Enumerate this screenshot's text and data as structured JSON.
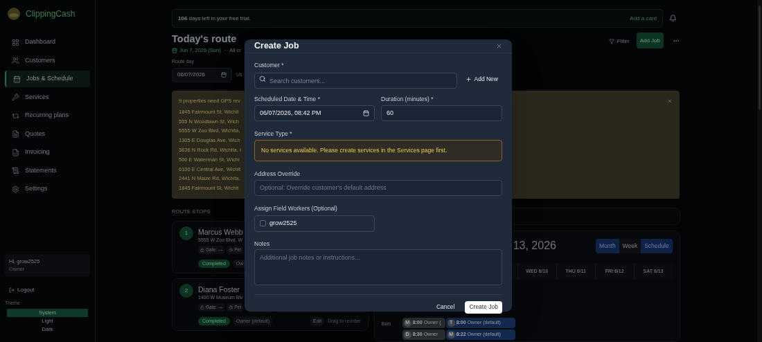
{
  "sidebar": {
    "brand": "ClippingCash",
    "items": [
      {
        "label": "Dashboard",
        "selected": false
      },
      {
        "label": "Customers",
        "selected": false
      },
      {
        "label": "Jobs & Schedule",
        "selected": true
      },
      {
        "label": "Services",
        "selected": false
      },
      {
        "label": "Recurring plans",
        "selected": false
      },
      {
        "label": "Quotes",
        "selected": false
      },
      {
        "label": "Invoicing",
        "selected": false
      },
      {
        "label": "Statements",
        "selected": false
      },
      {
        "label": "Settings",
        "selected": false
      }
    ],
    "user": {
      "greeting": "Hi, grow2525",
      "role": "Owner"
    },
    "logout": "Logout",
    "theme": {
      "label": "Theme",
      "options": [
        {
          "label": "System",
          "selected": true
        },
        {
          "label": "Light",
          "selected": false
        },
        {
          "label": "Dark",
          "selected": false
        }
      ]
    }
  },
  "trial": {
    "text": "**106** days left in your free trial.",
    "action": "Add a card"
  },
  "header": {
    "title": "Today's route",
    "date": "Jun 7, 2026 (Sun)",
    "separator": "·",
    "scope": "All cr",
    "filter": "Filter",
    "add_job": "Add Job"
  },
  "route_day": {
    "label": "Route day",
    "value": "06/07/2026",
    "hint": "Us"
  },
  "gps_notice": {
    "title": "9 properties need GPS rev",
    "addresses": [
      "1845 Fairmount St, Wichit",
      "555 N Woodlawn St, Wich",
      "5555 W Zoo Blvd, Wichita,",
      "1305 E Douglas Ave, Wich",
      "3636 N Rock Rd, Wichita, I",
      "500 E Waterman St, Wichi",
      "6100 E Central Ave, Wichit",
      "2441 N Maize Rd, Wichita,",
      "1845 Fairmount St, Wichit"
    ]
  },
  "route_stops": {
    "heading": "ROUTE STOPS",
    "stops": [
      {
        "number": "1",
        "name": "Marcus Webb",
        "address": "5555 W Zoo Blvd, W",
        "gate": "Gate: —",
        "pet": "Pet",
        "status": "Completed",
        "assignee": "Ow"
      },
      {
        "number": "2",
        "name": "Diana Foster",
        "address": "1400 W Museum Blv",
        "gate": "Gate: —",
        "pet": "Pet",
        "status": "Completed",
        "assignee": "Owner (default)",
        "edit": "Edit",
        "drag": "Drag to reorder"
      }
    ]
  },
  "calendar": {
    "title": "13, 2026",
    "views": [
      {
        "label": "Month",
        "selected": false
      },
      {
        "label": "Week",
        "selected": true
      },
      {
        "label": "Schedule",
        "selected": false
      }
    ],
    "days": [
      "WED 6/10",
      "THU 6/11",
      "FRI 6/12",
      "SAT 6/13"
    ],
    "time": "8am",
    "events": [
      {
        "initial": "M",
        "time": "8:00",
        "label": "Owner (",
        "color": "#2a2d33"
      },
      {
        "initial": "D",
        "time": "8:30",
        "label": "Owner",
        "color": "#2a2d33"
      },
      {
        "initial": "T",
        "time": "8:00",
        "label": "Owner (default)",
        "color": "#132a52"
      },
      {
        "initial": "M",
        "time": "8:22",
        "label": "Owner (default)",
        "color": "#132a52"
      }
    ]
  },
  "modal": {
    "title": "Create Job",
    "customer_label": "Customer *",
    "customer_placeholder": "Search customers...",
    "add_new": "Add New",
    "date_label": "Scheduled Date & Time *",
    "date_value": "06/07/2026, 08:42 PM",
    "duration_label": "Duration (minutes) *",
    "duration_value": "60",
    "service_label": "Service Type *",
    "service_warning": "No services available. Please create services in the Services page first.",
    "address_label": "Address Override",
    "address_placeholder": "Optional: Override customer's default address",
    "workers_label": "Assign Field Workers (Optional)",
    "workers": [
      {
        "name": "grow2525",
        "checked": false
      }
    ],
    "notes_label": "Notes",
    "notes_placeholder": "Additional job notes or instructions...",
    "cancel": "Cancel",
    "submit": "Create Job"
  }
}
